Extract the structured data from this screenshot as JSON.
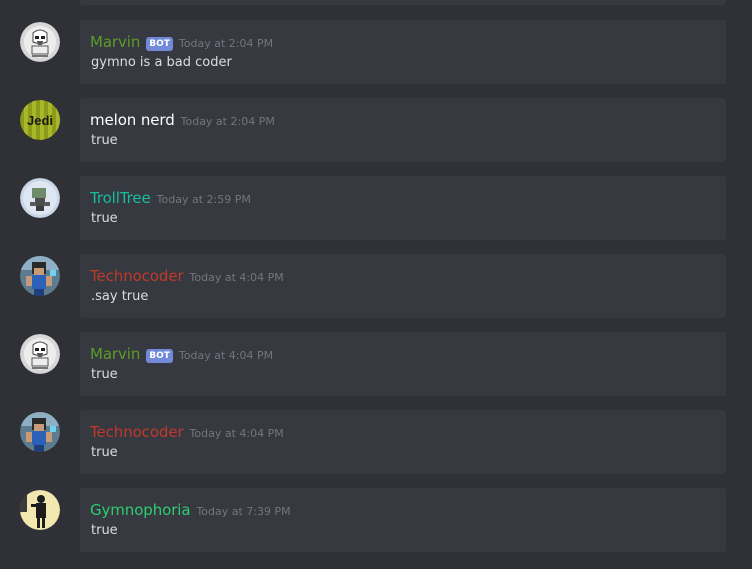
{
  "messages": [
    {
      "username": "Marvin",
      "username_color": "#5d9c26",
      "bot": true,
      "bot_label": "BOT",
      "timestamp": "Today at 2:04 PM",
      "content": "gymno is a bad coder",
      "avatar": "stormtrooper-avatar"
    },
    {
      "username": "melon nerd",
      "username_color": "#ffffff",
      "bot": false,
      "timestamp": "Today at 2:04 PM",
      "content": "true",
      "avatar": "jedi-avatar",
      "avatar_text": "Jedi"
    },
    {
      "username": "TrollTree",
      "username_color": "#1abc9c",
      "bot": false,
      "timestamp": "Today at 2:59 PM",
      "content": "true",
      "avatar": "trolltree-avatar"
    },
    {
      "username": "Technocoder",
      "username_color": "#c0392b",
      "bot": false,
      "timestamp": "Today at 4:04 PM",
      "content": ".say true",
      "avatar": "minecraft-avatar"
    },
    {
      "username": "Marvin",
      "username_color": "#5d9c26",
      "bot": true,
      "bot_label": "BOT",
      "timestamp": "Today at 4:04 PM",
      "content": "true",
      "avatar": "stormtrooper-avatar"
    },
    {
      "username": "Technocoder",
      "username_color": "#c0392b",
      "bot": false,
      "timestamp": "Today at 4:04 PM",
      "content": "true",
      "avatar": "minecraft-avatar"
    },
    {
      "username": "Gymnophoria",
      "username_color": "#2ecc71",
      "bot": false,
      "timestamp": "Today at 7:39 PM",
      "content": "true",
      "avatar": "gymnophoria-avatar"
    }
  ],
  "colors": {
    "background": "#2f3136",
    "card": "#36393f",
    "timestamp": "#72767d",
    "message_text": "#dcddde",
    "bot_tag": "#7289da"
  }
}
